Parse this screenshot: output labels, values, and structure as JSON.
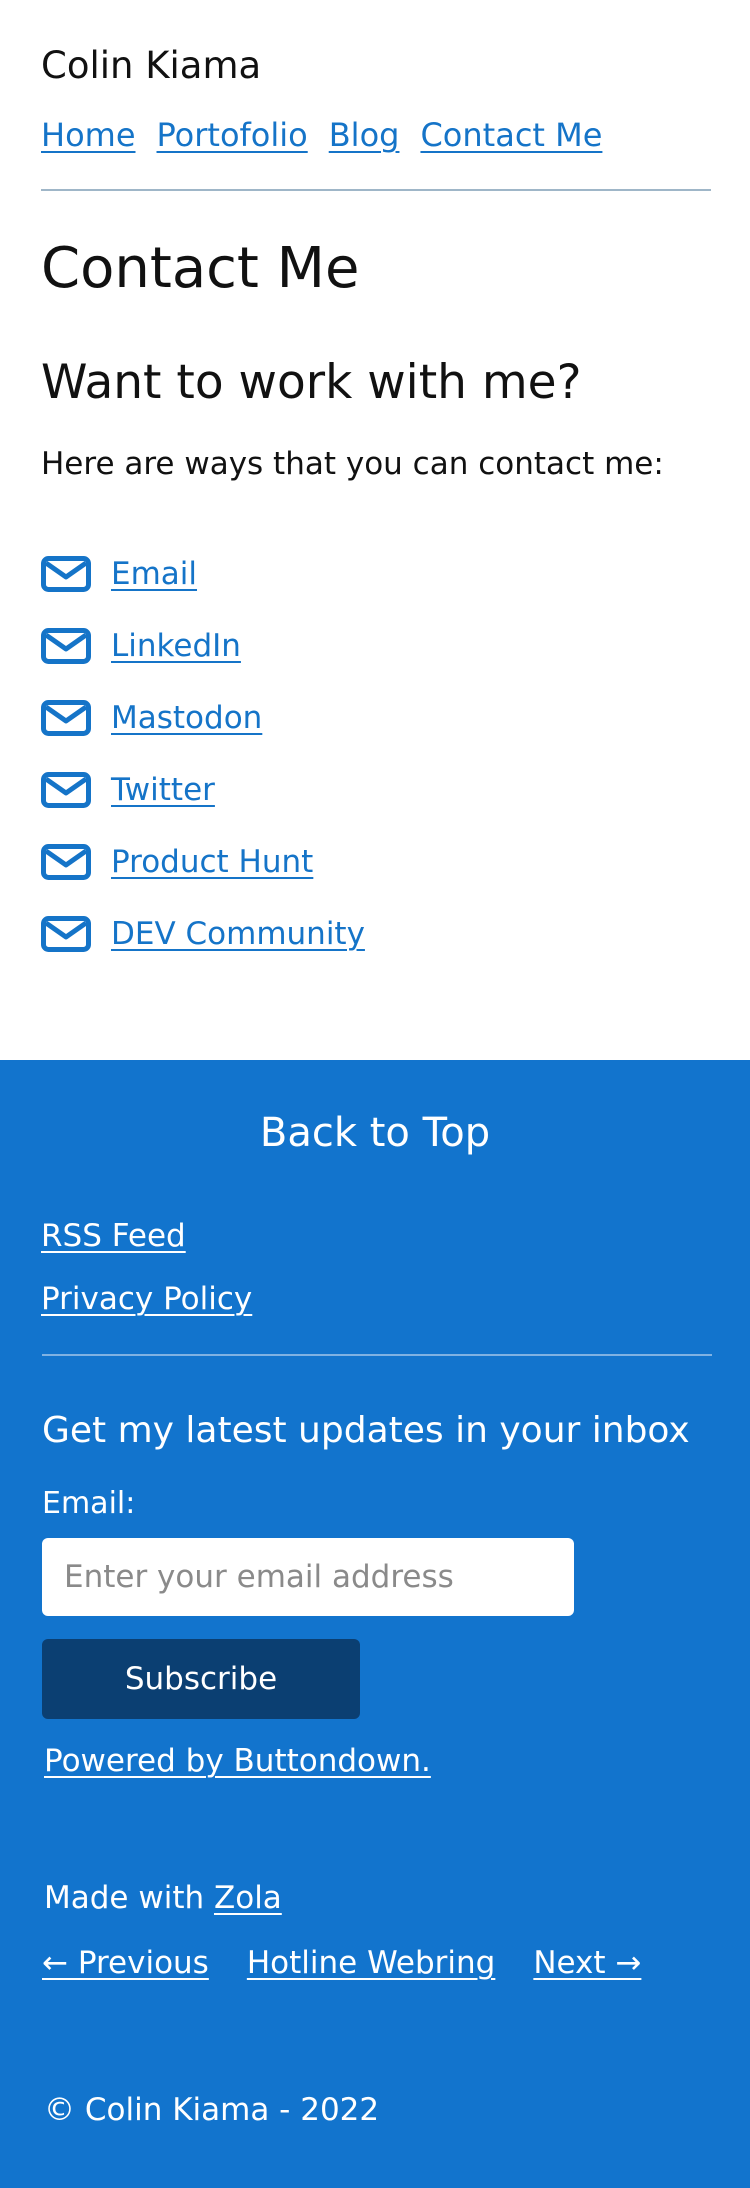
{
  "site": {
    "title": "Colin Kiama",
    "nav": [
      "Home",
      "Portofolio",
      "Blog",
      "Contact Me"
    ]
  },
  "main": {
    "title": "Contact Me",
    "subtitle": "Want to work with me?",
    "intro": "Here are ways that you can contact me:",
    "contacts": [
      {
        "label": "Email",
        "icon": "envelope-icon"
      },
      {
        "label": "LinkedIn",
        "icon": "envelope-icon"
      },
      {
        "label": "Mastodon",
        "icon": "envelope-icon"
      },
      {
        "label": "Twitter",
        "icon": "envelope-icon"
      },
      {
        "label": "Product Hunt",
        "icon": "envelope-icon"
      },
      {
        "label": "DEV Community",
        "icon": "envelope-icon"
      }
    ]
  },
  "footer": {
    "back_to_top": "Back to Top",
    "links": [
      "RSS Feed",
      "Privacy Policy"
    ],
    "newsletter": {
      "title": "Get my latest updates in your inbox",
      "email_label": "Email:",
      "placeholder": "Enter your email address",
      "email_value": "",
      "button": "Subscribe",
      "powered_by": "Powered by Buttondown."
    },
    "made_with_text": "Made with ",
    "made_with_link": "Zola",
    "webring": {
      "previous": "← Previous",
      "name": "Hotline Webring",
      "next": "Next →"
    },
    "copyright": "© Colin Kiama - 2022"
  },
  "colors": {
    "link": "#1574c8",
    "footer_bg": "#1274cd",
    "button_bg": "#0b3f72"
  }
}
